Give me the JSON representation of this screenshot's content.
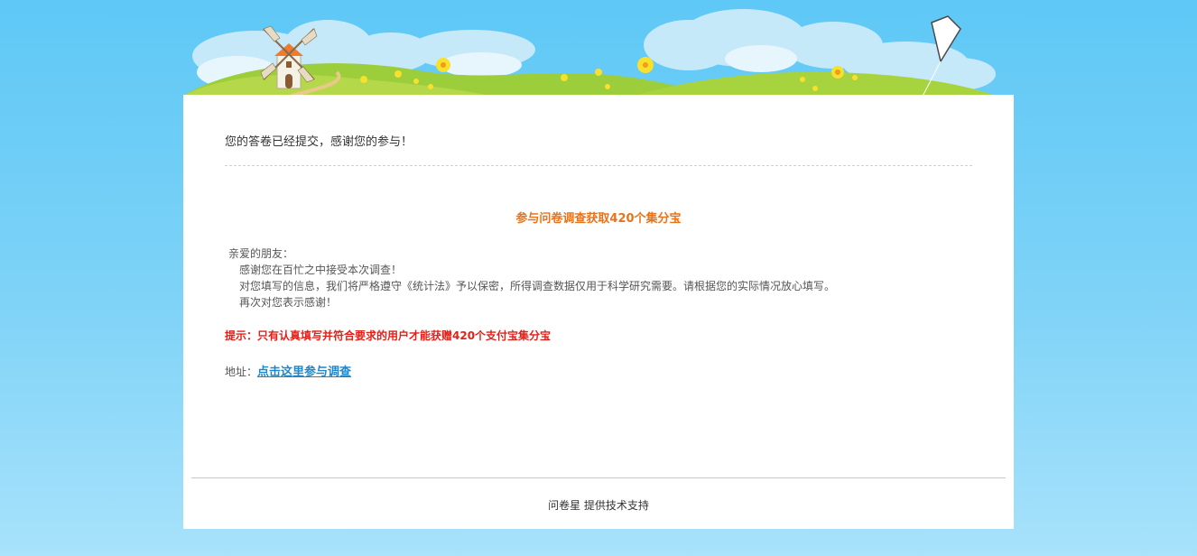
{
  "confirmation": {
    "message": "您的答卷已经提交，感谢您的参与！"
  },
  "promo": {
    "title": "参与问卷调查获取420个集分宝",
    "greeting": "亲爱的朋友：",
    "lines": [
      "感谢您在百忙之中接受本次调查！",
      "对您填写的信息，我们将严格遵守《统计法》予以保密，所得调查数据仅用于科学研究需要。请根据您的实际情况放心填写。",
      "再次对您表示感谢！"
    ],
    "tip": "提示：只有认真填写并符合要求的用户才能获赠420个支付宝集分宝",
    "address_label": "地址：",
    "link_text": "点击这里参与调查"
  },
  "footer": {
    "text": "问卷星 提供技术支持"
  },
  "colors": {
    "sky": "#5ec8f6",
    "promo_title": "#e8731a",
    "tip": "#e0211a",
    "link": "#1e87c9"
  }
}
